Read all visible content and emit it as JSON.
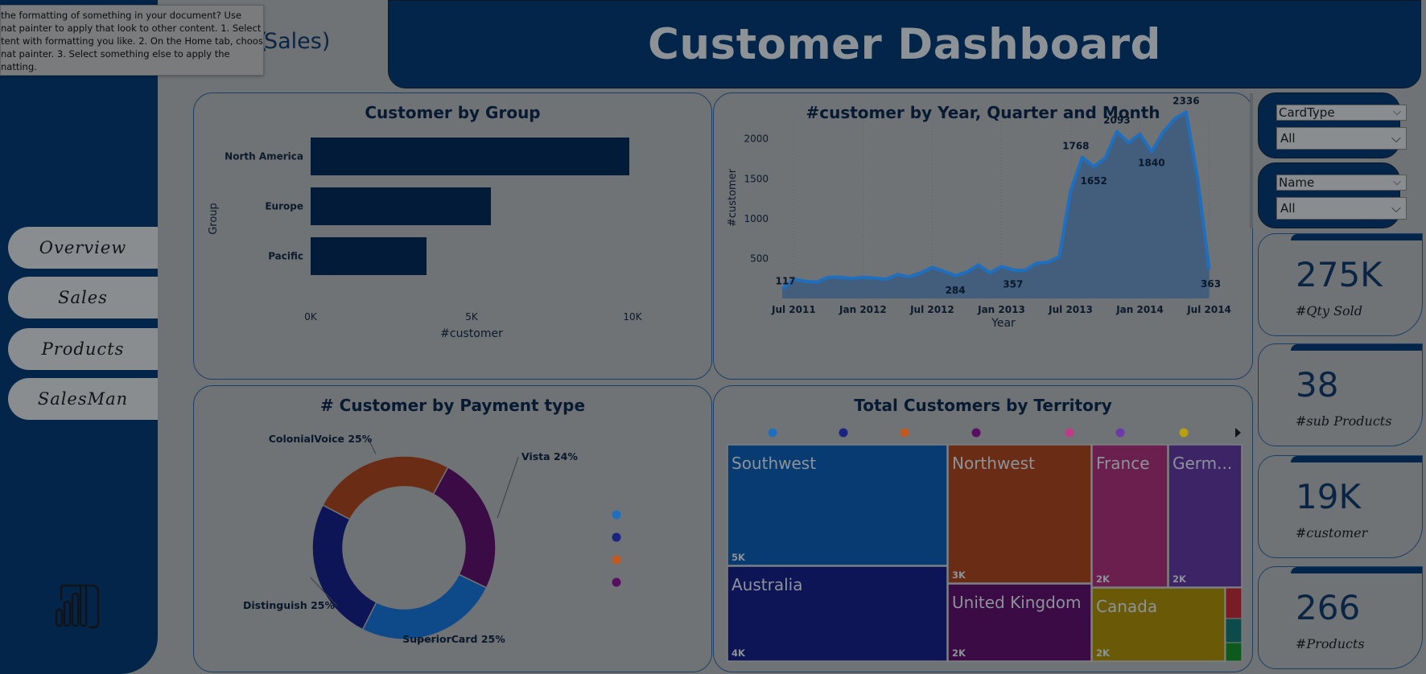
{
  "header": {
    "title": "Customer Dashboard",
    "subtitle_partial": "Sales)"
  },
  "tooltip": {
    "lines": [
      " the formatting of something in your document? Use",
      "nat painter to apply that look to other content. 1. Select",
      "tent with formatting you like. 2. On the Home tab, choose",
      "nat painter. 3. Select something else to apply the",
      "natting."
    ]
  },
  "nav": {
    "items": [
      {
        "label": "Overview"
      },
      {
        "label": "Sales"
      },
      {
        "label": "Products"
      },
      {
        "label": "SalesMan"
      }
    ]
  },
  "slicers": [
    {
      "header": "CardType",
      "value": "All"
    },
    {
      "header": "Name",
      "value": "All"
    }
  ],
  "kpis": [
    {
      "value": "275K",
      "label": "#Qty Sold"
    },
    {
      "value": "38",
      "label": "#sub Products"
    },
    {
      "value": "19K",
      "label": "#customer"
    },
    {
      "value": "266",
      "label": "#Products"
    }
  ],
  "colors": {
    "navy": "#03254a",
    "bg": "#6f7375",
    "bar": "#021b38",
    "line": "#1f6fc0"
  },
  "chart_data": [
    {
      "type": "bar",
      "title": "Customer by Group",
      "ylabel": "Group",
      "xlabel": "#customer",
      "categories": [
        "North America",
        "Europe",
        "Pacific"
      ],
      "values": [
        9900,
        5600,
        3600
      ],
      "xlim": [
        0,
        10000
      ],
      "xticks": [
        "0K",
        "5K",
        "10K"
      ]
    },
    {
      "type": "area",
      "title": "#customer by Year, Quarter and Month",
      "ylabel": "#customer",
      "xlabel": "Year",
      "ylim": [
        0,
        2400
      ],
      "yticks": [
        "500",
        "1000",
        "1500",
        "2000"
      ],
      "xticks": [
        "Jul 2011",
        "Jan 2012",
        "Jul 2012",
        "Jan 2013",
        "Jul 2013",
        "Jan 2014",
        "Jul 2014"
      ],
      "x": [
        "2011-06",
        "2011-07",
        "2011-08",
        "2011-09",
        "2011-10",
        "2011-11",
        "2011-12",
        "2012-01",
        "2012-02",
        "2012-03",
        "2012-04",
        "2012-05",
        "2012-06",
        "2012-07",
        "2012-08",
        "2012-09",
        "2012-10",
        "2012-11",
        "2012-12",
        "2013-01",
        "2013-02",
        "2013-03",
        "2013-04",
        "2013-05",
        "2013-06",
        "2013-07",
        "2013-08",
        "2013-09",
        "2013-10",
        "2013-11",
        "2013-12",
        "2014-01",
        "2014-02",
        "2014-03",
        "2014-04",
        "2014-05",
        "2014-06",
        "2014-07"
      ],
      "values": [
        117,
        240,
        215,
        205,
        265,
        265,
        250,
        265,
        255,
        240,
        300,
        270,
        320,
        390,
        340,
        284,
        330,
        420,
        320,
        400,
        357,
        350,
        440,
        455,
        520,
        1350,
        1768,
        1652,
        1760,
        2093,
        1950,
        2060,
        1840,
        2080,
        2250,
        2336,
        1500,
        363
      ],
      "labels": [
        {
          "x": "2011-06",
          "text": "117"
        },
        {
          "x": "2012-09",
          "text": "284"
        },
        {
          "x": "2013-02",
          "text": "357"
        },
        {
          "x": "2013-08",
          "text": "1768"
        },
        {
          "x": "2013-09",
          "text": "1652"
        },
        {
          "x": "2013-11",
          "text": "2093"
        },
        {
          "x": "2014-02",
          "text": "1840"
        },
        {
          "x": "2014-05",
          "text": "2336"
        },
        {
          "x": "2014-07",
          "text": "363"
        }
      ]
    },
    {
      "type": "pie",
      "title": "# Customer by Payment type",
      "slices": [
        {
          "name": "Vista",
          "value": 24,
          "label": "Vista 24%",
          "color": "#3a0b45"
        },
        {
          "name": "SuperiorCard",
          "value": 25,
          "label": "SuperiorCard 25%",
          "color": "#0e4a8a"
        },
        {
          "name": "Distinguish",
          "value": 25,
          "label": "Distinguish 25%",
          "color": "#0d1557"
        },
        {
          "name": "ColonialVoice",
          "value": 25,
          "label": "ColonialVoice 25%",
          "color": "#6a2c14"
        }
      ],
      "legend_colors": [
        "#1f6fc0",
        "#1b2380",
        "#c2581e",
        "#5a0e62"
      ]
    },
    {
      "type": "treemap",
      "title": "Total Customers by Territory",
      "legend_colors": [
        "#1f6fc0",
        "#1b2380",
        "#c2581e",
        "#5a0e62",
        "#c23a8a",
        "#6a3aa8",
        "#b8a010"
      ],
      "items": [
        {
          "name": "Southwest",
          "value": "5K",
          "color": "#073b72"
        },
        {
          "name": "Australia",
          "value": "4K",
          "color": "#0d1557"
        },
        {
          "name": "Northwest",
          "value": "3K",
          "color": "#6a2c14"
        },
        {
          "name": "United Kingdom",
          "value": "2K",
          "color": "#3a0b45"
        },
        {
          "name": "France",
          "value": "2K",
          "color": "#6a1f4e"
        },
        {
          "name": "Germ...",
          "value": "2K",
          "color": "#3d2466"
        },
        {
          "name": "Canada",
          "value": "2K",
          "color": "#6a5a08"
        }
      ]
    }
  ]
}
